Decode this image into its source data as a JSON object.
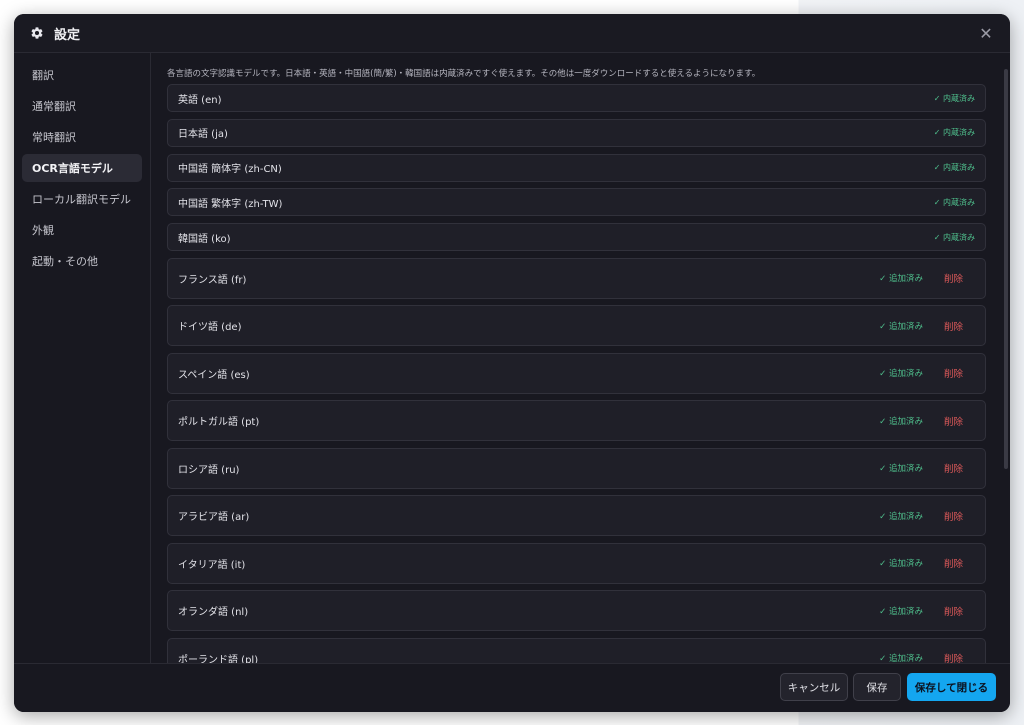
{
  "window": {
    "title": "設定"
  },
  "sidebar": {
    "items": [
      {
        "label": "翻訳",
        "active": false
      },
      {
        "label": "通常翻訳",
        "active": false
      },
      {
        "label": "常時翻訳",
        "active": false
      },
      {
        "label": "OCR言語モデル",
        "active": true
      },
      {
        "label": "ローカル翻訳モデル",
        "active": false
      },
      {
        "label": "外観",
        "active": false
      },
      {
        "label": "起動・その他",
        "active": false
      }
    ]
  },
  "main": {
    "description": "各言語の文字認識モデルです。日本語・英語・中国語(簡/繁)・韓国語は内蔵済みですぐ使えます。その他は一度ダウンロードすると使えるようになります。",
    "builtin_languages": [
      {
        "name": "英語 (en)",
        "status": "✓ 内蔵済み"
      },
      {
        "name": "日本語 (ja)",
        "status": "✓ 内蔵済み"
      },
      {
        "name": "中国語 簡体字 (zh-CN)",
        "status": "✓ 内蔵済み"
      },
      {
        "name": "中国語 繁体字 (zh-TW)",
        "status": "✓ 内蔵済み"
      },
      {
        "name": "韓国語 (ko)",
        "status": "✓ 内蔵済み"
      }
    ],
    "added_languages": [
      {
        "name": "フランス語 (fr)",
        "status": "✓ 追加済み",
        "delete_label": "削除"
      },
      {
        "name": "ドイツ語 (de)",
        "status": "✓ 追加済み",
        "delete_label": "削除"
      },
      {
        "name": "スペイン語 (es)",
        "status": "✓ 追加済み",
        "delete_label": "削除"
      },
      {
        "name": "ポルトガル語 (pt)",
        "status": "✓ 追加済み",
        "delete_label": "削除"
      },
      {
        "name": "ロシア語 (ru)",
        "status": "✓ 追加済み",
        "delete_label": "削除"
      },
      {
        "name": "アラビア語 (ar)",
        "status": "✓ 追加済み",
        "delete_label": "削除"
      },
      {
        "name": "イタリア語 (it)",
        "status": "✓ 追加済み",
        "delete_label": "削除"
      },
      {
        "name": "オランダ語 (nl)",
        "status": "✓ 追加済み",
        "delete_label": "削除"
      },
      {
        "name": "ポーランド語 (pl)",
        "status": "✓ 追加済み",
        "delete_label": "削除"
      }
    ]
  },
  "footer": {
    "cancel_label": "キャンセル",
    "save_label": "保存",
    "save_close_label": "保存して閉じる"
  },
  "icons": {
    "title_icon": "gear-icon",
    "close_icon": "close-icon"
  },
  "colors": {
    "accent": "#14a6f0",
    "success": "#4fc08d",
    "danger": "#e05a5a",
    "background": "#181820"
  }
}
